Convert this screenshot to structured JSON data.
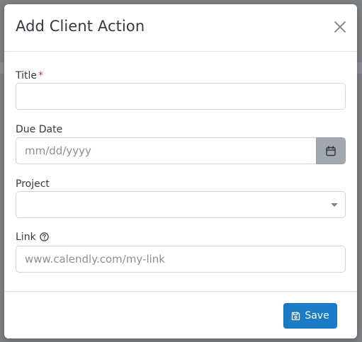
{
  "modal": {
    "title": "Add Client Action",
    "close_icon": "close-icon"
  },
  "form": {
    "title_field": {
      "label": "Title",
      "required_mark": "*",
      "value": "",
      "placeholder": ""
    },
    "due_date_field": {
      "label": "Due Date",
      "value": "",
      "placeholder": "mm/dd/yyyy",
      "button_icon": "calendar-icon"
    },
    "project_field": {
      "label": "Project",
      "selected": "",
      "caret_icon": "caret-down-icon"
    },
    "link_field": {
      "label": "Link",
      "help_icon": "help-circle-icon",
      "value": "",
      "placeholder": "www.calendly.com/my-link"
    }
  },
  "footer": {
    "save_label": "Save",
    "save_icon": "save-icon"
  },
  "colors": {
    "primary": "#1a7cc7",
    "required": "#dc3545",
    "date_button": "#a3a8ae",
    "backdrop": "#7c7f83"
  }
}
